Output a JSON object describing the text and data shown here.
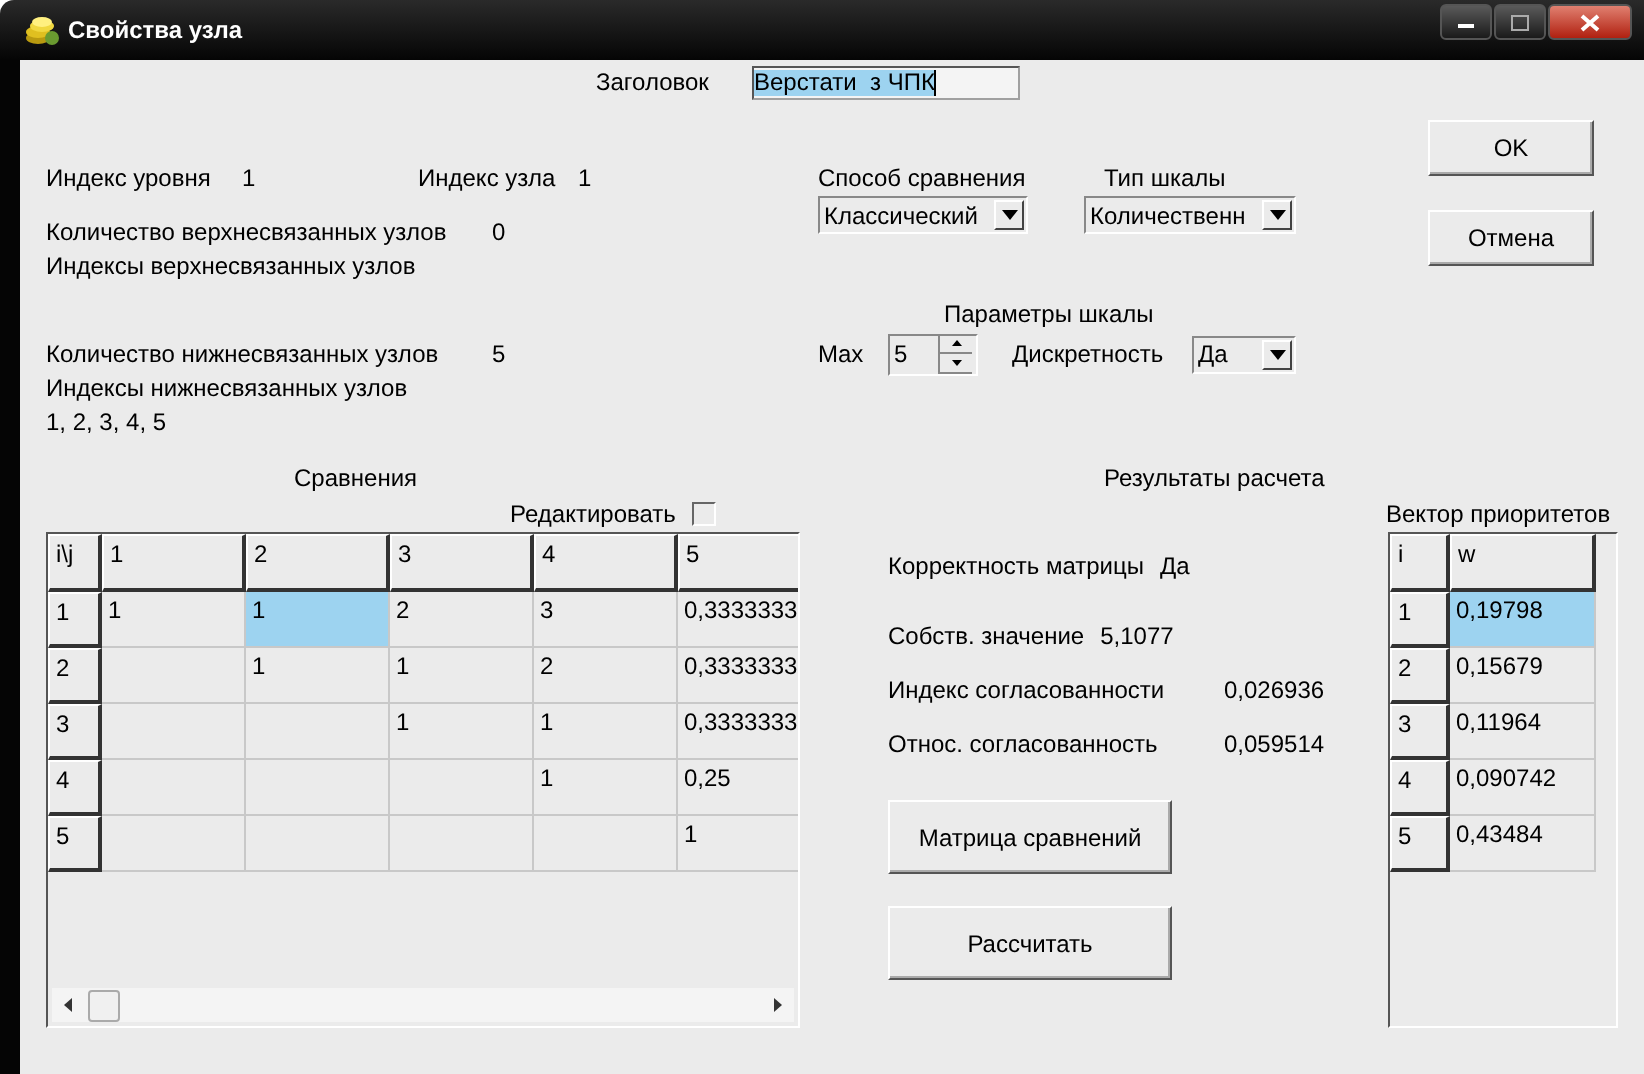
{
  "window": {
    "title": "Свойства узла"
  },
  "header": {
    "label": "Заголовок",
    "value": "Верстати  з ЧПК"
  },
  "info": {
    "level_label": "Индекс уровня",
    "level_value": "1",
    "node_label": "Индекс узла",
    "node_value": "1",
    "upper_count_label": "Количество верхнесвязанных узлов",
    "upper_count_value": "0",
    "upper_indices_label": "Индексы верхнесвязанных узлов",
    "lower_count_label": "Количество нижнесвязанных узлов",
    "lower_count_value": "5",
    "lower_indices_label": "Индексы нижнесвязанных узлов",
    "lower_indices_value": "1, 2, 3, 4, 5"
  },
  "method": {
    "label": "Способ сравнения",
    "value": "Классический"
  },
  "scale_type": {
    "label": "Тип шкалы",
    "value": "Количественн"
  },
  "scale_params": {
    "label": "Параметры шкалы",
    "max_label": "Max",
    "max_value": "5",
    "discrete_label": "Дискретность",
    "discrete_value": "Да"
  },
  "buttons": [
    "OK",
    "Отмена"
  ],
  "comparisons": {
    "title": "Сравнения",
    "edit_label": "Редактировать",
    "edit_checked": false,
    "corner": "i\\j",
    "columns": [
      "1",
      "2",
      "3",
      "4",
      "5"
    ],
    "rows": [
      {
        "index": "1",
        "cells": [
          {
            "text": "1",
            "selected": false
          },
          {
            "text": "1",
            "selected": true
          },
          {
            "text": "2",
            "selected": false
          },
          {
            "text": "3",
            "selected": false
          },
          {
            "text": "0,3333333",
            "selected": false
          }
        ]
      },
      {
        "index": "2",
        "cells": [
          {
            "selected": false
          },
          {
            "text": "1",
            "selected": false
          },
          {
            "text": "1",
            "selected": false
          },
          {
            "text": "2",
            "selected": false
          },
          {
            "text": "0,3333333",
            "selected": false
          }
        ]
      },
      {
        "index": "3",
        "cells": [
          {
            "selected": false
          },
          {
            "selected": false
          },
          {
            "text": "1",
            "selected": false
          },
          {
            "text": "1",
            "selected": false
          },
          {
            "text": "0,3333333",
            "selected": false
          }
        ]
      },
      {
        "index": "4",
        "cells": [
          {
            "selected": false
          },
          {
            "selected": false
          },
          {
            "selected": false
          },
          {
            "text": "1",
            "selected": false
          },
          {
            "text": "0,25",
            "selected": false
          }
        ]
      },
      {
        "index": "5",
        "cells": [
          {
            "selected": false
          },
          {
            "selected": false
          },
          {
            "selected": false
          },
          {
            "selected": false
          },
          {
            "text": "1",
            "selected": false
          }
        ]
      }
    ]
  },
  "results": {
    "title": "Результаты расчета",
    "lines": [
      {
        "label": "Корректность матрицы",
        "value": "Да"
      },
      {
        "label": "Собств. значение",
        "value": "5,1077"
      },
      {
        "label": "Индекс согласованности",
        "value": "0,026936"
      },
      {
        "label": "Относ. согласованность",
        "value": "0,059514"
      }
    ],
    "buttons": [
      "Матрица сравнений",
      "Рассчитать"
    ]
  },
  "priorities": {
    "title": "Вектор приоритетов",
    "corner": "i",
    "columns": [
      "w"
    ],
    "rows": [
      {
        "i": "1",
        "w": "0,19798",
        "selected": true
      },
      {
        "i": "2",
        "w": "0,15679",
        "selected": false
      },
      {
        "i": "3",
        "w": "0,11964",
        "selected": false
      },
      {
        "i": "4",
        "w": "0,090742",
        "selected": false
      },
      {
        "i": "5",
        "w": "0,43484",
        "selected": false
      }
    ]
  }
}
